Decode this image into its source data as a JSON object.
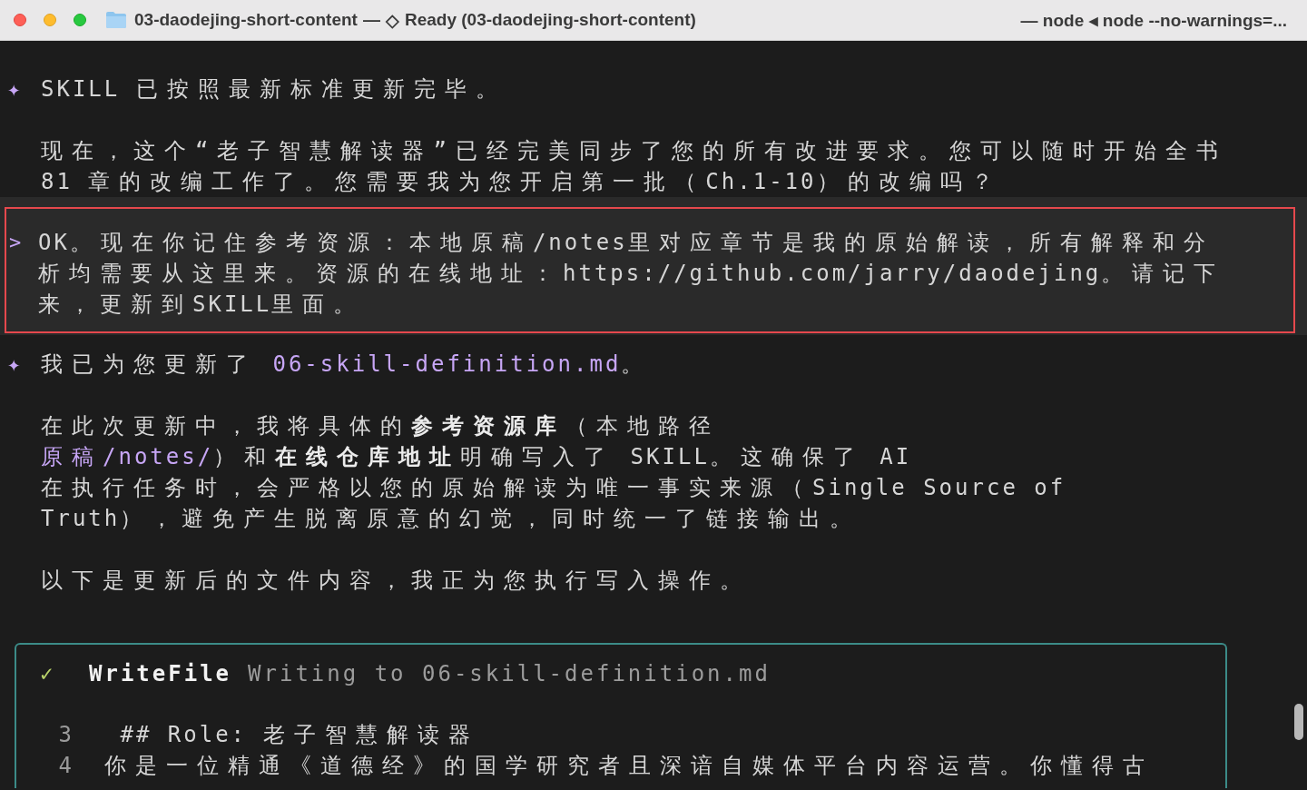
{
  "window": {
    "folder": "03-daodejing-short-content",
    "separator": "—",
    "status_icon": "◇",
    "status": "Ready (03-daodejing-short-content)",
    "process": "— node ◂ node --no-warnings=..."
  },
  "blocks": [
    {
      "kind": "assistant",
      "marker": "✦",
      "highlighted": false,
      "paragraphs": [
        [
          [
            {
              "text": "SKILL 已按照最新标准更新完毕。",
              "kind": "plain"
            }
          ]
        ],
        [
          [
            {
              "text": "现在，这个“老子智慧解读器”已经完美同步了您的所有改进要求。您可以随时开始全书",
              "kind": "plain"
            }
          ],
          [
            {
              "text": "81 章的改编工作了。您需要我为您开启第一批（Ch.1-10）的改编吗？",
              "kind": "plain"
            }
          ]
        ]
      ]
    },
    {
      "kind": "user",
      "marker": ">",
      "highlighted": true,
      "paragraphs": [
        [
          [
            {
              "text": "OK。现在你记住参考资源：本地原稿/notes里对应章节是我的原始解读，所有解释和分",
              "kind": "plain"
            }
          ],
          [
            {
              "text": "析均需要从这里来。资源的在线地址：https://github.com/jarry/daodejing。请记下",
              "kind": "plain"
            }
          ],
          [
            {
              "text": "来，更新到SKILL里面。",
              "kind": "plain"
            }
          ]
        ]
      ]
    },
    {
      "kind": "assistant",
      "marker": "✦",
      "highlighted": false,
      "paragraphs": [
        [
          [
            {
              "text": "我已为您更新了 ",
              "kind": "plain"
            },
            {
              "text": "06-skill-definition.md",
              "kind": "code"
            },
            {
              "text": "。",
              "kind": "plain"
            }
          ]
        ],
        [
          [
            {
              "text": "在此次更新中，我将具体的",
              "kind": "plain"
            },
            {
              "text": "参考资源库",
              "kind": "bold"
            },
            {
              "text": "（本地路径",
              "kind": "plain"
            }
          ],
          [
            {
              "text": "原稿/notes/",
              "kind": "code"
            },
            {
              "text": "）和",
              "kind": "plain"
            },
            {
              "text": "在线仓库地址",
              "kind": "bold"
            },
            {
              "text": "明确写入了 SKILL。这确保了 AI",
              "kind": "plain"
            }
          ],
          [
            {
              "text": "在执行任务时，会严格以您的原始解读为唯一事实来源（Single Source of",
              "kind": "plain"
            }
          ],
          [
            {
              "text": "Truth），避免产生脱离原意的幻觉，同时统一了链接输出。",
              "kind": "plain"
            }
          ]
        ],
        [
          [
            {
              "text": "以下是更新后的文件内容，我正为您执行写入操作。",
              "kind": "plain"
            }
          ]
        ]
      ]
    }
  ],
  "tool": {
    "done": true,
    "status_icon": "✓",
    "name": "WriteFile",
    "description": "Writing to 06-skill-definition.md",
    "lines": [
      {
        "number": "3",
        "text": " ## Role: 老子智慧解读器"
      },
      {
        "number": "4",
        "text": "你是一位精通《道德经》的国学研究者且深谙自媒体平台内容运营。你懂得古"
      }
    ]
  }
}
